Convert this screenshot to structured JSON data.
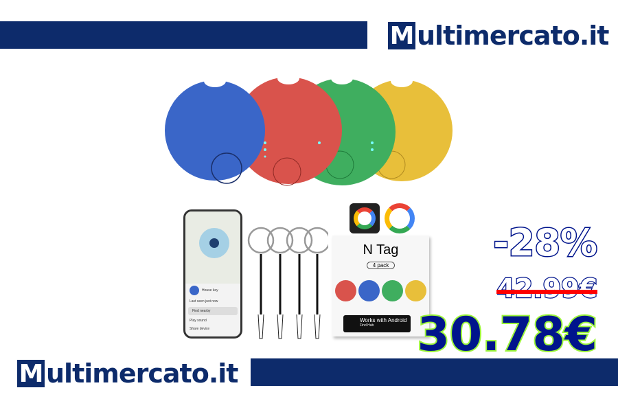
{
  "brand": {
    "logo_initial": "M",
    "logo_rest": "ultimercato.it",
    "color": "#0d2b6b"
  },
  "product": {
    "box_title": "N Tag",
    "box_pack": "4 pack",
    "badge_title": "Works with Android",
    "badge_subtitle": "Find Hub",
    "colors": [
      "#3a66c8",
      "#d9534c",
      "#3fae5f",
      "#e8bf3a"
    ],
    "phone": {
      "device_name": "House key",
      "device_status": "Last seen just now",
      "find_nearby": "Find nearby",
      "play_sound": "Play sound",
      "share_device": "Share device"
    }
  },
  "pricing": {
    "discount": "-28%",
    "old_price": "42.99€",
    "new_price": "30.78€"
  }
}
